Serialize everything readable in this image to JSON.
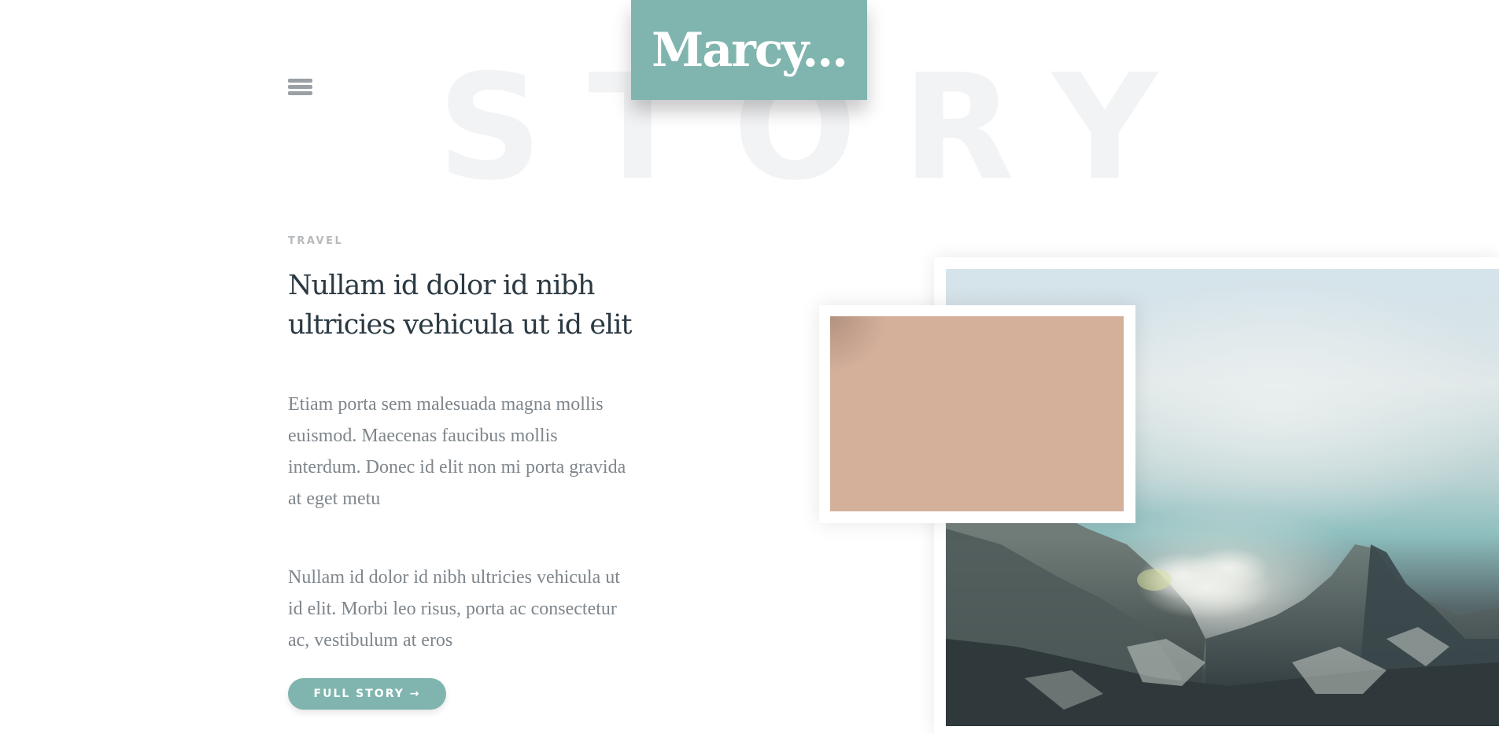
{
  "background_word": "STORY",
  "logo": {
    "text": "Marcy..."
  },
  "menu": {
    "icon": "hamburger-icon"
  },
  "article": {
    "category": "TRAVEL",
    "title": "Nullam id dolor id nibh ultricies vehicula ut id elit",
    "paragraphs": [
      "Etiam porta sem malesuada magna mollis euismod. Maecenas faucibus mollis interdum. Donec id elit non mi porta gravida at eget metu",
      "Nullam id dolor id nibh ultricies vehicula ut id elit. Morbi leo risus, porta ac consectetur ac, vestibulum at eros"
    ],
    "cta_label": "FULL STORY →"
  },
  "colors": {
    "accent": "#7fb5ae",
    "heading": "#2b3942",
    "body_text": "#7e868c",
    "muted": "#b7babd",
    "card": "#d4b09b"
  }
}
